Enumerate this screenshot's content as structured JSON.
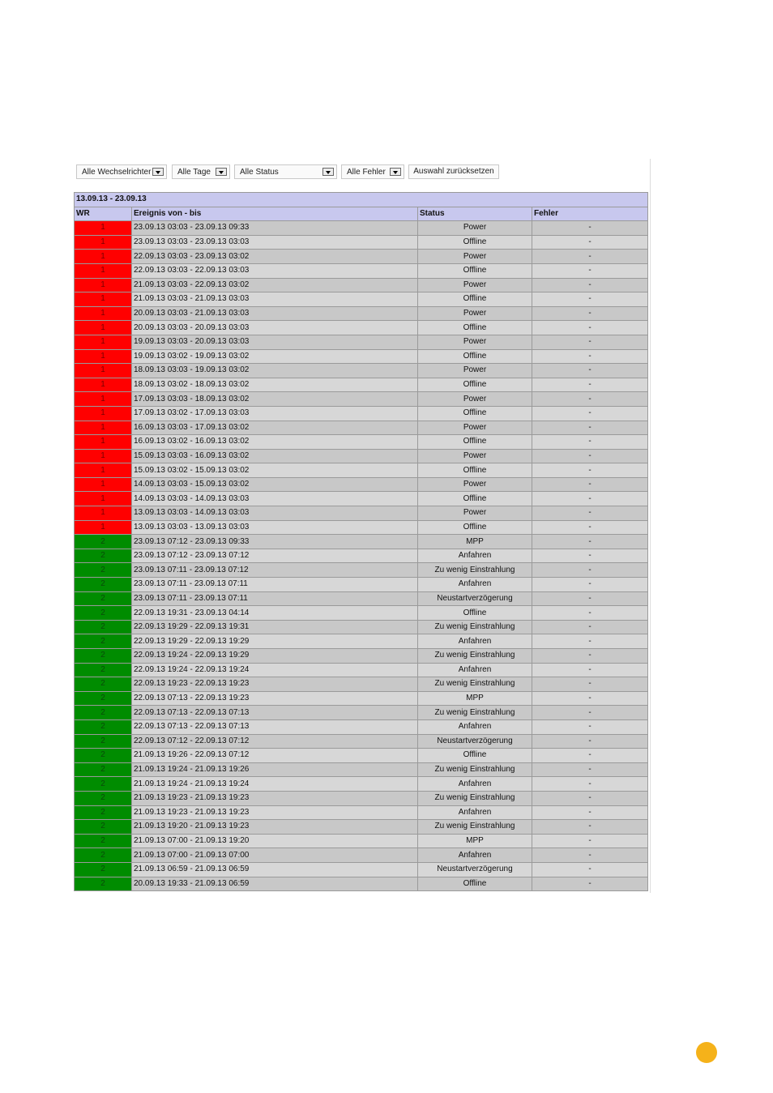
{
  "filters": {
    "inverters": "Alle Wechselrichter",
    "days": "Alle Tage",
    "status": "Alle Status",
    "errors": "Alle Fehler",
    "reset": "Auswahl zurücksetzen"
  },
  "table": {
    "range": "13.09.13 - 23.09.13",
    "headers": [
      "WR",
      "Ereignis von - bis",
      "Status",
      "Fehler"
    ],
    "rows": [
      {
        "wr": "1",
        "time": "23.09.13 03:03 - 23.09.13 09:33",
        "status": "Power",
        "error": "-"
      },
      {
        "wr": "1",
        "time": "23.09.13 03:03 - 23.09.13 03:03",
        "status": "Offline",
        "error": "-"
      },
      {
        "wr": "1",
        "time": "22.09.13 03:03 - 23.09.13 03:02",
        "status": "Power",
        "error": "-"
      },
      {
        "wr": "1",
        "time": "22.09.13 03:03 - 22.09.13 03:03",
        "status": "Offline",
        "error": "-"
      },
      {
        "wr": "1",
        "time": "21.09.13 03:03 - 22.09.13 03:02",
        "status": "Power",
        "error": "-"
      },
      {
        "wr": "1",
        "time": "21.09.13 03:03 - 21.09.13 03:03",
        "status": "Offline",
        "error": "-"
      },
      {
        "wr": "1",
        "time": "20.09.13 03:03 - 21.09.13 03:03",
        "status": "Power",
        "error": "-"
      },
      {
        "wr": "1",
        "time": "20.09.13 03:03 - 20.09.13 03:03",
        "status": "Offline",
        "error": "-"
      },
      {
        "wr": "1",
        "time": "19.09.13 03:03 - 20.09.13 03:03",
        "status": "Power",
        "error": "-"
      },
      {
        "wr": "1",
        "time": "19.09.13 03:02 - 19.09.13 03:02",
        "status": "Offline",
        "error": "-"
      },
      {
        "wr": "1",
        "time": "18.09.13 03:03 - 19.09.13 03:02",
        "status": "Power",
        "error": "-"
      },
      {
        "wr": "1",
        "time": "18.09.13 03:02 - 18.09.13 03:02",
        "status": "Offline",
        "error": "-"
      },
      {
        "wr": "1",
        "time": "17.09.13 03:03 - 18.09.13 03:02",
        "status": "Power",
        "error": "-"
      },
      {
        "wr": "1",
        "time": "17.09.13 03:02 - 17.09.13 03:03",
        "status": "Offline",
        "error": "-"
      },
      {
        "wr": "1",
        "time": "16.09.13 03:03 - 17.09.13 03:02",
        "status": "Power",
        "error": "-"
      },
      {
        "wr": "1",
        "time": "16.09.13 03:02 - 16.09.13 03:02",
        "status": "Offline",
        "error": "-"
      },
      {
        "wr": "1",
        "time": "15.09.13 03:03 - 16.09.13 03:02",
        "status": "Power",
        "error": "-"
      },
      {
        "wr": "1",
        "time": "15.09.13 03:02 - 15.09.13 03:02",
        "status": "Offline",
        "error": "-"
      },
      {
        "wr": "1",
        "time": "14.09.13 03:03 - 15.09.13 03:02",
        "status": "Power",
        "error": "-"
      },
      {
        "wr": "1",
        "time": "14.09.13 03:03 - 14.09.13 03:03",
        "status": "Offline",
        "error": "-"
      },
      {
        "wr": "1",
        "time": "13.09.13 03:03 - 14.09.13 03:03",
        "status": "Power",
        "error": "-"
      },
      {
        "wr": "1",
        "time": "13.09.13 03:03 - 13.09.13 03:03",
        "status": "Offline",
        "error": "-"
      },
      {
        "wr": "2",
        "time": "23.09.13 07:12 - 23.09.13 09:33",
        "status": "MPP",
        "error": "-"
      },
      {
        "wr": "2",
        "time": "23.09.13 07:12 - 23.09.13 07:12",
        "status": "Anfahren",
        "error": "-"
      },
      {
        "wr": "2",
        "time": "23.09.13 07:11 - 23.09.13 07:12",
        "status": "Zu wenig Einstrahlung",
        "error": "-"
      },
      {
        "wr": "2",
        "time": "23.09.13 07:11 - 23.09.13 07:11",
        "status": "Anfahren",
        "error": "-"
      },
      {
        "wr": "2",
        "time": "23.09.13 07:11 - 23.09.13 07:11",
        "status": "Neustartverzögerung",
        "error": "-"
      },
      {
        "wr": "2",
        "time": "22.09.13 19:31 - 23.09.13 04:14",
        "status": "Offline",
        "error": "-"
      },
      {
        "wr": "2",
        "time": "22.09.13 19:29 - 22.09.13 19:31",
        "status": "Zu wenig Einstrahlung",
        "error": "-"
      },
      {
        "wr": "2",
        "time": "22.09.13 19:29 - 22.09.13 19:29",
        "status": "Anfahren",
        "error": "-"
      },
      {
        "wr": "2",
        "time": "22.09.13 19:24 - 22.09.13 19:29",
        "status": "Zu wenig Einstrahlung",
        "error": "-"
      },
      {
        "wr": "2",
        "time": "22.09.13 19:24 - 22.09.13 19:24",
        "status": "Anfahren",
        "error": "-"
      },
      {
        "wr": "2",
        "time": "22.09.13 19:23 - 22.09.13 19:23",
        "status": "Zu wenig Einstrahlung",
        "error": "-"
      },
      {
        "wr": "2",
        "time": "22.09.13 07:13 - 22.09.13 19:23",
        "status": "MPP",
        "error": "-"
      },
      {
        "wr": "2",
        "time": "22.09.13 07:13 - 22.09.13 07:13",
        "status": "Zu wenig Einstrahlung",
        "error": "-"
      },
      {
        "wr": "2",
        "time": "22.09.13 07:13 - 22.09.13 07:13",
        "status": "Anfahren",
        "error": "-"
      },
      {
        "wr": "2",
        "time": "22.09.13 07:12 - 22.09.13 07:12",
        "status": "Neustartverzögerung",
        "error": "-"
      },
      {
        "wr": "2",
        "time": "21.09.13 19:26 - 22.09.13 07:12",
        "status": "Offline",
        "error": "-"
      },
      {
        "wr": "2",
        "time": "21.09.13 19:24 - 21.09.13 19:26",
        "status": "Zu wenig Einstrahlung",
        "error": "-"
      },
      {
        "wr": "2",
        "time": "21.09.13 19:24 - 21.09.13 19:24",
        "status": "Anfahren",
        "error": "-"
      },
      {
        "wr": "2",
        "time": "21.09.13 19:23 - 21.09.13 19:23",
        "status": "Zu wenig Einstrahlung",
        "error": "-"
      },
      {
        "wr": "2",
        "time": "21.09.13 19:23 - 21.09.13 19:23",
        "status": "Anfahren",
        "error": "-"
      },
      {
        "wr": "2",
        "time": "21.09.13 19:20 - 21.09.13 19:23",
        "status": "Zu wenig Einstrahlung",
        "error": "-"
      },
      {
        "wr": "2",
        "time": "21.09.13 07:00 - 21.09.13 19:20",
        "status": "MPP",
        "error": "-"
      },
      {
        "wr": "2",
        "time": "21.09.13 07:00 - 21.09.13 07:00",
        "status": "Anfahren",
        "error": "-"
      },
      {
        "wr": "2",
        "time": "21.09.13 06:59 - 21.09.13 06:59",
        "status": "Neustartverzögerung",
        "error": "-"
      },
      {
        "wr": "2",
        "time": "20.09.13 19:33 - 21.09.13 06:59",
        "status": "Offline",
        "error": "-"
      }
    ]
  },
  "colors": {
    "inverter_1": "#ff0000",
    "inverter_2": "#008c00",
    "header": "#c8c8ee",
    "page_dot": "#f5b21a"
  }
}
